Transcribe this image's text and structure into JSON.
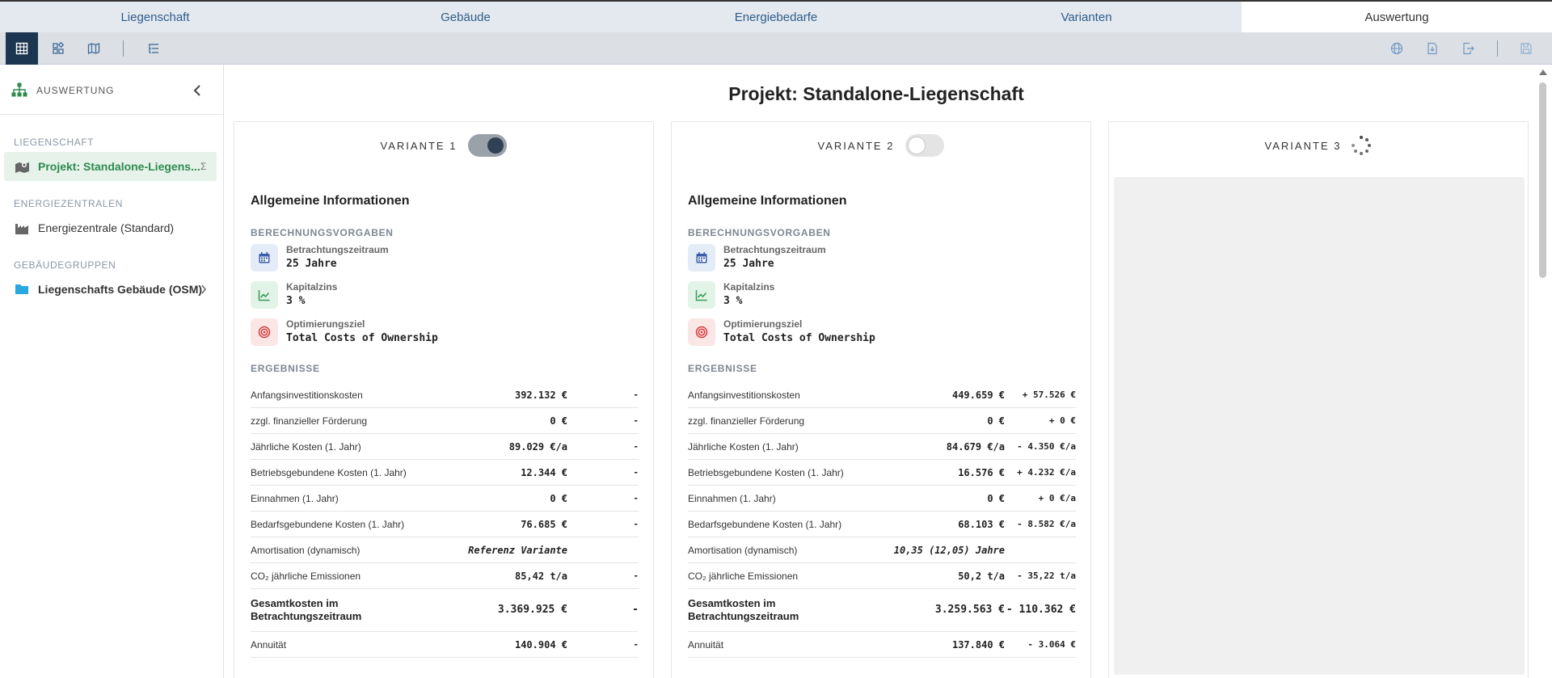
{
  "tabs": [
    {
      "label": "Liegenschaft"
    },
    {
      "label": "Gebäude"
    },
    {
      "label": "Energiebedarfe"
    },
    {
      "label": "Varianten"
    },
    {
      "label": "Auswertung",
      "active": true
    }
  ],
  "toolbar": {
    "left_icons": [
      "table-icon",
      "widgets-icon",
      "map-icon",
      "tree-list-icon"
    ],
    "right_icons": [
      "globe-icon",
      "file-import-icon",
      "file-export-icon",
      "save-icon"
    ]
  },
  "sidebar": {
    "title": "AUSWERTUNG",
    "sections": [
      {
        "title": "LIEGENSCHAFT",
        "items": [
          {
            "label": "Projekt: Standalone-Liegens...",
            "suffix": "Σ",
            "active": true,
            "icon": "property-map-icon"
          }
        ]
      },
      {
        "title": "ENERGIEZENTRALEN",
        "items": [
          {
            "label": "Energiezentrale (Standard)",
            "icon": "factory-icon"
          }
        ]
      },
      {
        "title": "GEBÄUDEGRUPPEN",
        "items": [
          {
            "label": "Liegenschafts Gebäude (OSM)",
            "icon": "folder-icon"
          }
        ]
      }
    ]
  },
  "main": {
    "title": "Projekt: Standalone-Liegenschaft",
    "variants": [
      {
        "label": "VARIANTE 1",
        "toggle": "on",
        "general_title": "Allgemeine Informationen",
        "params_title": "BERECHNUNGSVORGABEN",
        "params": [
          {
            "label": "Betrachtungszeitraum",
            "value": "25 Jahre",
            "icon": "calendar-icon"
          },
          {
            "label": "Kapitalzins",
            "value": "3 %",
            "icon": "trending-up-icon"
          },
          {
            "label": "Optimierungsziel",
            "value": "Total Costs of Ownership",
            "icon": "target-icon"
          }
        ],
        "results_title": "ERGEBNISSE",
        "results": [
          {
            "label": "Anfangsinvestitionskosten",
            "value": "392.132 €",
            "diff": "-"
          },
          {
            "label": "zzgl. finanzieller Förderung",
            "value": "0 €",
            "diff": "-"
          },
          {
            "label": "Jährliche Kosten (1. Jahr)",
            "value": "89.029 €/a",
            "diff": "-"
          },
          {
            "label": "Betriebsgebundene Kosten (1. Jahr)",
            "value": "12.344 €",
            "diff": "-"
          },
          {
            "label": "Einnahmen (1. Jahr)",
            "value": "0 €",
            "diff": "-"
          },
          {
            "label": "Bedarfsgebundene Kosten (1. Jahr)",
            "value": "76.685 €",
            "diff": "-"
          },
          {
            "label": "Amortisation (dynamisch)",
            "value": "Referenz Variante",
            "diff": ""
          },
          {
            "label": "CO₂ jährliche Emissionen",
            "value": "85,42 t/a",
            "diff": "-"
          },
          {
            "label": "Gesamtkosten im Betrachtungszeitraum",
            "value": "3.369.925 €",
            "diff": "-"
          },
          {
            "label": "Annuität",
            "value": "140.904 €",
            "diff": "-"
          }
        ]
      },
      {
        "label": "VARIANTE 2",
        "toggle": "off",
        "general_title": "Allgemeine Informationen",
        "params_title": "BERECHNUNGSVORGABEN",
        "params": [
          {
            "label": "Betrachtungszeitraum",
            "value": "25 Jahre",
            "icon": "calendar-icon"
          },
          {
            "label": "Kapitalzins",
            "value": "3 %",
            "icon": "trending-up-icon"
          },
          {
            "label": "Optimierungsziel",
            "value": "Total Costs of Ownership",
            "icon": "target-icon"
          }
        ],
        "results_title": "ERGEBNISSE",
        "results": [
          {
            "label": "Anfangsinvestitionskosten",
            "value": "449.659 €",
            "diff": "+ 57.526 €"
          },
          {
            "label": "zzgl. finanzieller Förderung",
            "value": "0 €",
            "diff": "+ 0 €"
          },
          {
            "label": "Jährliche Kosten (1. Jahr)",
            "value": "84.679 €/a",
            "diff": "- 4.350 €/a"
          },
          {
            "label": "Betriebsgebundene Kosten (1. Jahr)",
            "value": "16.576 €",
            "diff": "+ 4.232 €/a"
          },
          {
            "label": "Einnahmen (1. Jahr)",
            "value": "0 €",
            "diff": "+ 0 €/a"
          },
          {
            "label": "Bedarfsgebundene Kosten (1. Jahr)",
            "value": "68.103 €",
            "diff": "- 8.582 €/a"
          },
          {
            "label": "Amortisation (dynamisch)",
            "value": "10,35 (12,05) Jahre",
            "diff": ""
          },
          {
            "label": "CO₂ jährliche Emissionen",
            "value": "50,2 t/a",
            "diff": "- 35,22 t/a"
          },
          {
            "label": "Gesamtkosten im Betrachtungszeitraum",
            "value": "3.259.563 €",
            "diff": "- 110.362 €"
          },
          {
            "label": "Annuität",
            "value": "137.840 €",
            "diff": "- 3.064 €"
          }
        ]
      },
      {
        "label": "VARIANTE 3",
        "toggle": "loading"
      }
    ]
  },
  "colors": {
    "accent_green": "#2e8b4e",
    "tab_text": "#2e5d8a",
    "toolbar_active": "#1c3550",
    "sidebar_active_bg": "#e6f2ea"
  }
}
